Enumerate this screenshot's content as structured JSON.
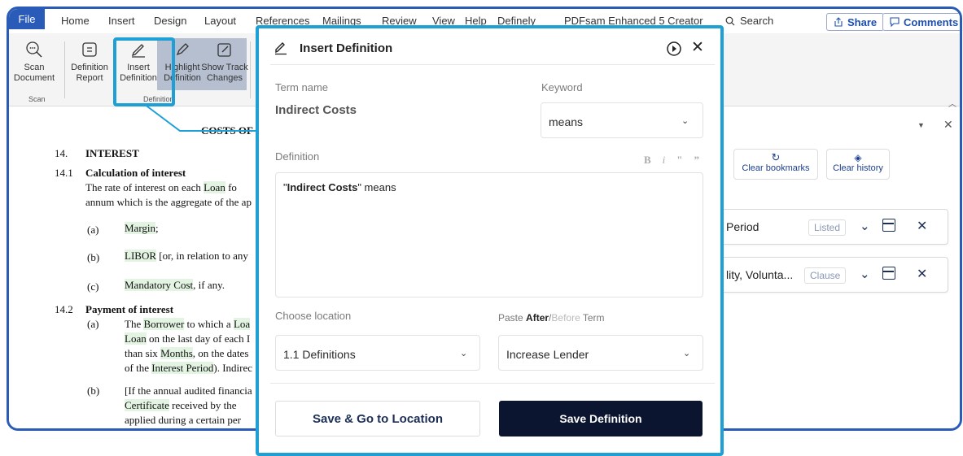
{
  "menu": {
    "file": "File",
    "items": [
      "Home",
      "Insert",
      "Design",
      "Layout",
      "References",
      "Mailings",
      "Review",
      "View",
      "Help",
      "Definely",
      "PDFsam Enhanced 5 Creator"
    ],
    "search": "Search",
    "share": "Share",
    "comments": "Comments"
  },
  "ribbon": {
    "scan": {
      "line1": "Scan",
      "line2": "Document"
    },
    "definition_report": {
      "line1": "Definition",
      "line2": "Report"
    },
    "insert_definition": {
      "line1": "Insert",
      "line2": "Definition"
    },
    "highlight_definition": {
      "line1": "Highlight",
      "line2": "Definition"
    },
    "show_track": {
      "line1": "Show Track",
      "line2": "Changes"
    },
    "group_scan": "Scan",
    "group_definition": "Definition"
  },
  "document": {
    "heading": "COSTS OF",
    "s14_num": "14.",
    "s14_title": "INTEREST",
    "s141_num": "14.1",
    "s141_title": "Calculation of interest",
    "p1a": "The rate of interest on each ",
    "p1_loan": "Loan",
    "p1b": " fo",
    "p2": "annum which is the aggregate of the ap",
    "a_label": "(a)",
    "a_text": "Margin",
    "a_end": ";",
    "b_label": "(b)",
    "b_libor": "LIBOR",
    "b_text": " [or, in relation to any",
    "c_label": "(c)",
    "c_text": "Mandatory Cost",
    "c_end": ", if any.",
    "s142_num": "14.2",
    "s142_title": "Payment of interest",
    "pa_label": "(a)",
    "pa_l1a": "The ",
    "pa_borrower": "Borrower",
    "pa_l1b": " to which a ",
    "pa_loa": "Loa",
    "pa_l2a": "Loan",
    "pa_l2b": " on the last day of each I",
    "pa_l3a": "than six ",
    "pa_months": "Months",
    "pa_l3b": ", on the dates",
    "pa_l4a": "of the ",
    "pa_ip": "Interest Period",
    "pa_l4b": "). Indirec",
    "pb_label": "(b)",
    "pb_l1": "[If the annual audited financia",
    "pb_cert": "Certificate",
    "pb_l2b": " received by the",
    "pb_l3": "applied during a certain per"
  },
  "right_panel": {
    "clear_bookmarks": "Clear bookmarks",
    "clear_history": "Clear history",
    "card1_title": "Period",
    "card1_badge": "Listed",
    "card2_title": "lity, Volunta...",
    "card2_badge": "Clause"
  },
  "dialog": {
    "title": "Insert Definition",
    "term_name_label": "Term name",
    "term_name_value": "Indirect Costs",
    "keyword_label": "Keyword",
    "keyword_value": "means",
    "definition_label": "Definition",
    "fmt_bold": "B",
    "fmt_italic": "i",
    "fmt_open_quote": "\"",
    "fmt_close_quote": "”",
    "def_quote_open": "\"",
    "def_term": "Indirect Costs",
    "def_quote_close": "\"",
    "def_rest": " means",
    "location_label": "Choose location",
    "location_value": "1.1 Definitions",
    "paste_prefix": "Paste ",
    "paste_after": "After",
    "paste_slash": "/",
    "paste_before": "Before",
    "paste_suffix": " Term",
    "paste_value": "Increase Lender",
    "save_go": "Save & Go to Location",
    "save_def": "Save Definition"
  },
  "colors": {
    "accent": "#2b5bb8",
    "callout": "#1ea0d6",
    "dark_button": "#0c1530",
    "term_highlight": "#e3f4e3"
  }
}
